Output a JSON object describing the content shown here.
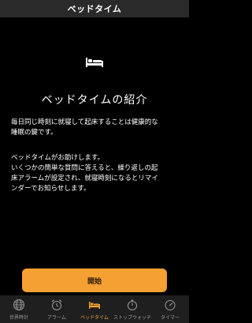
{
  "header": {
    "title": "ベッドタイム"
  },
  "content": {
    "icon": "bed-icon",
    "intro_title": "ベッドタイムの紹介",
    "paragraph1": "毎日同じ時刻に就寝して起床することは健康的な\n睡眠の鍵です。",
    "paragraph2": "ベッドタイムがお助けします。\nいくつかの簡単な質問に答えると、繰り返しの起\n床アラームが設定され、就寝時刻になるとリマイ\nンダーでお知らせします。",
    "start_button": "開始"
  },
  "tabbar": {
    "active": "bedtime",
    "items": [
      {
        "label": "世界時計",
        "icon": "globe-icon"
      },
      {
        "label": "アラーム",
        "icon": "alarm-clock-icon"
      },
      {
        "label": "ベッドタイム",
        "icon": "bed-icon"
      },
      {
        "label": "ストップウォッチ",
        "icon": "stopwatch-icon"
      },
      {
        "label": "タイマー",
        "icon": "timer-icon"
      }
    ]
  },
  "colors": {
    "accent": "#f5a032",
    "background": "#000000",
    "header": "#2a2a2a",
    "tabbar": "#1f1f1f"
  }
}
